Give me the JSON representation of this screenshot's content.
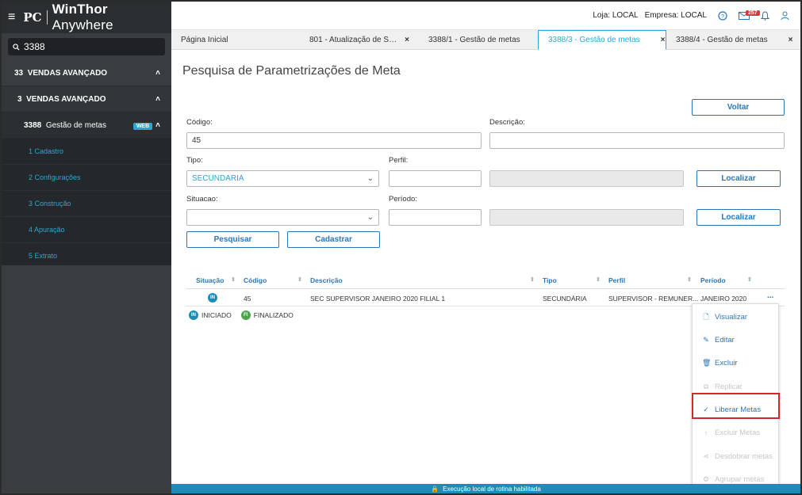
{
  "brand": {
    "logo": "PC",
    "name_bold": "WinThor",
    "name_light": "Anywhere"
  },
  "sidebar": {
    "search_value": "3388",
    "groups": [
      {
        "code": "33",
        "label": "VENDAS AVANÇADO"
      },
      {
        "code": "3",
        "label": "VENDAS AVANÇADO"
      },
      {
        "code": "3388",
        "label": "Gestão de metas",
        "badge": "WEB"
      }
    ],
    "items": [
      {
        "label": "1  Cadastro"
      },
      {
        "label": "2  Configurações"
      },
      {
        "label": "3  Construção"
      },
      {
        "label": "4  Apuração"
      },
      {
        "label": "5  Extrato"
      }
    ]
  },
  "topbar": {
    "loja": "Loja: LOCAL",
    "empresa": "Empresa: LOCAL",
    "mail_count": "257"
  },
  "tabs": [
    {
      "label": "Página Inicial"
    },
    {
      "label": "801 - Atualização de Serviços ..."
    },
    {
      "label": "3388/1 - Gestão de metas"
    },
    {
      "label": "3388/3 - Gestão de metas"
    },
    {
      "label": "3388/4 - Gestão de metas"
    }
  ],
  "page": {
    "title": "Pesquisa de Parametrizações de Meta",
    "voltar": "Voltar",
    "codigo_label": "Código:",
    "codigo_value": "45",
    "descricao_label": "Descrição:",
    "tipo_label": "Tipo:",
    "tipo_value": "SECUNDARIA",
    "perfil_label": "Perfil:",
    "situacao_label": "Situacao:",
    "periodo_label": "Período:",
    "localizar": "Localizar",
    "pesquisar": "Pesquisar",
    "cadastrar": "Cadastrar"
  },
  "table": {
    "headers": [
      "Situação",
      "Código",
      "Descrição",
      "Tipo",
      "Perfil",
      "Período"
    ],
    "rows": [
      {
        "situacao": "IN",
        "codigo": "45",
        "descricao": "SEC SUPERVISOR JANEIRO 2020 FILIAL 1",
        "tipo": "SECUNDÁRIA",
        "perfil": "SUPERVISOR - REMUNER...",
        "periodo": "JANEIRO 2020"
      }
    ],
    "more": "..."
  },
  "legend": [
    {
      "badge": "IN",
      "label": "INICIADO"
    },
    {
      "badge": "FI",
      "label": "FINALIZADO"
    }
  ],
  "context_menu": [
    {
      "label": "Visualizar",
      "icon": "file-icon",
      "enabled": true
    },
    {
      "label": "Editar",
      "icon": "pencil-icon",
      "enabled": true
    },
    {
      "label": "Excluir",
      "icon": "trash-icon",
      "enabled": true
    },
    {
      "label": "Replicar",
      "icon": "copy-icon",
      "enabled": false
    },
    {
      "label": "Liberar Metas",
      "icon": "check-icon",
      "enabled": true
    },
    {
      "label": "Excluir Metas",
      "icon": "arrow-icon",
      "enabled": false
    },
    {
      "label": "Desdobrar metas",
      "icon": "share-icon",
      "enabled": false
    },
    {
      "label": "Agrupar metas",
      "icon": "gear-icon",
      "enabled": false
    }
  ],
  "status": {
    "text": "Execução local de rotina habilitada"
  },
  "colors": {
    "accent": "#2aa7d8",
    "primary": "#2a76b8",
    "sidebar": "#3a3d40",
    "highlight": "#d7262b"
  }
}
